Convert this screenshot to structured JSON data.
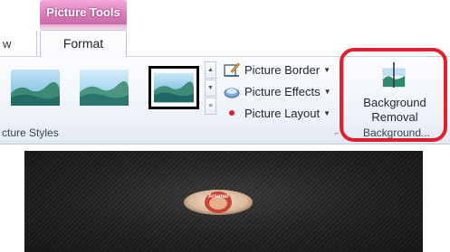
{
  "ribbon": {
    "contextual_tab": "Picture Tools",
    "left_tab_fragment": "w",
    "active_tab": "Format",
    "picture_styles": {
      "thumbnails": [
        "picture-style-1",
        "picture-style-2",
        "picture-style-3-selected"
      ],
      "group_label": "cture Styles"
    },
    "commands": [
      {
        "label": "Picture Border",
        "icon": "picture-border-icon"
      },
      {
        "label": "Picture Effects",
        "icon": "picture-effects-icon"
      },
      {
        "label": "Picture Layout",
        "icon": "picture-layout-icon"
      }
    ],
    "background": {
      "button_line1": "Background",
      "button_line2": "Removal",
      "group_label": "Background..."
    }
  },
  "colors": {
    "contextual_tab": "#d87bb7",
    "highlight": "#e0202e"
  },
  "photo": {
    "badge_text": "Arsenal"
  }
}
